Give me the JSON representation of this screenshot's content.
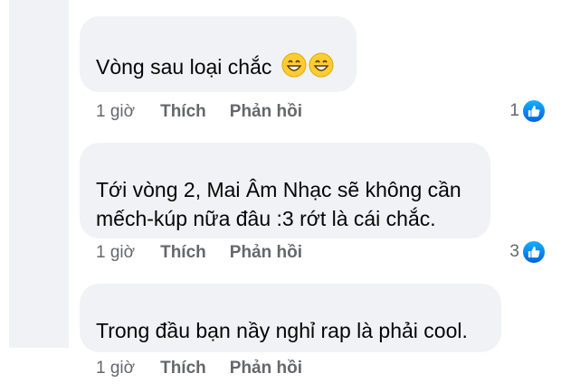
{
  "comments": [
    {
      "text": "Vòng sau loại chắc",
      "emoji_icons": [
        "grinning-face-emoji",
        "grinning-face-emoji"
      ],
      "time": "1 giờ",
      "like_label": "Thích",
      "reply_label": "Phản hồi",
      "reaction_count": "1",
      "reaction_icon": "like-icon"
    },
    {
      "text_line1": "Tới vòng 2, Mai Âm Nhạc sẽ không cần",
      "text_line2": "mếch-kúp nữa đâu :3 rớt là cái chắc.",
      "time": "1 giờ",
      "like_label": "Thích",
      "reply_label": "Phản hồi",
      "reaction_count": "3",
      "reaction_icon": "like-icon"
    },
    {
      "text": "Trong đầu bạn nầy nghỉ rap là phải cool.",
      "time": "1 giờ",
      "like_label": "Thích",
      "reply_label": "Phản hồi"
    }
  ],
  "colors": {
    "bubble_bg": "#f0f2f5",
    "meta_text": "#65676b",
    "like_blue": "#0866ff"
  }
}
